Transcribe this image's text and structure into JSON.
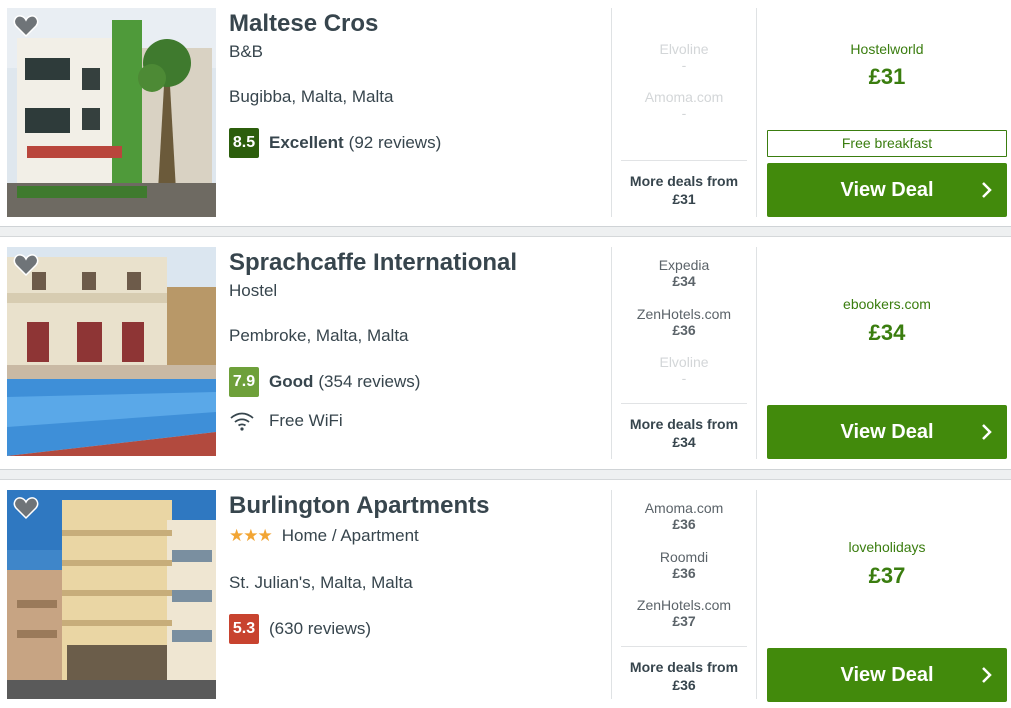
{
  "colors": {
    "accent_green": "#428a0c",
    "deal_green": "#3a7d0f",
    "score_excellent": "#2c5e0c",
    "score_good": "#6ea03a",
    "score_poor": "#c8432f",
    "stars": "#f2a534"
  },
  "hotels": [
    {
      "name": "Maltese Cros",
      "type": "B&B",
      "location": "Bugibba, Malta, Malta",
      "score": "8.5",
      "rating_word": "Excellent",
      "reviews": "(92 reviews)",
      "deals": [
        {
          "provider": "Elvoline",
          "price": "-"
        },
        {
          "provider": "Amoma.com",
          "price": "-"
        }
      ],
      "more_deals_label": "More deals from",
      "more_deals_price": "£31",
      "best_provider": "Hostelworld",
      "best_price": "£31",
      "perk": "Free breakfast",
      "button": "View Deal",
      "icons": [
        "heart-icon",
        "chevron-right-icon"
      ]
    },
    {
      "name": "Sprachcaffe International",
      "type": "Hostel",
      "location": "Pembroke, Malta, Malta",
      "score": "7.9",
      "rating_word": "Good",
      "reviews": "(354 reviews)",
      "amenity": "Free WiFi",
      "deals": [
        {
          "provider": "Expedia",
          "price": "£34"
        },
        {
          "provider": "ZenHotels.com",
          "price": "£36"
        },
        {
          "provider": "Elvoline",
          "price": "-"
        }
      ],
      "more_deals_label": "More deals from",
      "more_deals_price": "£34",
      "best_provider": "ebookers.com",
      "best_price": "£34",
      "button": "View Deal",
      "icons": [
        "heart-icon",
        "wifi-icon",
        "chevron-right-icon"
      ]
    },
    {
      "name": "Burlington Apartments",
      "star_rating": 3,
      "type": "Home / Apartment",
      "location": "St. Julian's, Malta, Malta",
      "score": "5.3",
      "reviews": "(630 reviews)",
      "deals": [
        {
          "provider": "Amoma.com",
          "price": "£36"
        },
        {
          "provider": "Roomdi",
          "price": "£36"
        },
        {
          "provider": "ZenHotels.com",
          "price": "£37"
        }
      ],
      "more_deals_label": "More deals from",
      "more_deals_price": "£36",
      "best_provider": "loveholidays",
      "best_price": "£37",
      "button": "View Deal",
      "icons": [
        "heart-icon",
        "star-icon",
        "chevron-right-icon"
      ]
    }
  ]
}
